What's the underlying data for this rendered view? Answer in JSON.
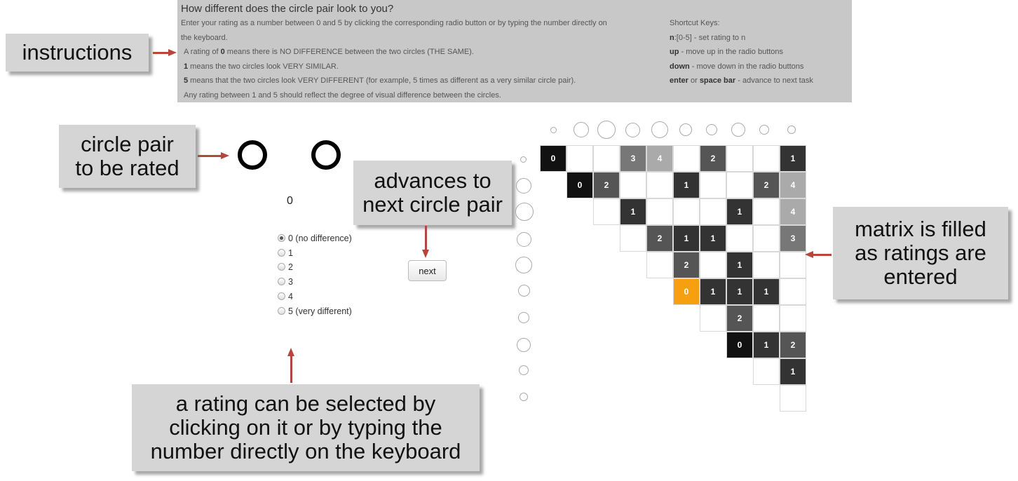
{
  "instructions": {
    "title": "How different does the circle pair look to you?",
    "line1": "Enter your rating as a number between 0 and 5 by clicking the corresponding radio button or by typing the number directly on",
    "line2": "the keyboard.",
    "line3_pre": "A rating of ",
    "line3_bold": "0",
    "line3_post": " means there is NO DIFFERENCE between the two circles (THE SAME).",
    "line4_bold": "1",
    "line4_post": " means the two circles look VERY SIMILAR.",
    "line5_bold": "5",
    "line5_post": " means that the two circles look VERY DIFFERENT (for example, 5 times as different as a very similar circle pair).",
    "line6": "Any rating between 1 and 5 should reflect the degree of visual difference between the circles.",
    "shortcuts_title": "Shortcut Keys:",
    "sc1_key": "n",
    "sc1_text": ":[0-5] - set rating to n",
    "sc2_key": "up",
    "sc2_text": " - move up in the radio buttons",
    "sc3_key": "down",
    "sc3_text": " - move down in the radio buttons",
    "sc4_key1": "enter",
    "sc4_mid": " or ",
    "sc4_key2": "space bar",
    "sc4_text": " - advance to next task"
  },
  "callouts": {
    "instructions": "instructions",
    "circle_pair_1": "circle pair",
    "circle_pair_2": "to be rated",
    "advances_1": "advances to",
    "advances_2": "next circle pair",
    "matrix_1": "matrix is filled",
    "matrix_2": "as ratings are",
    "matrix_3": "entered",
    "rating_1": "a rating can be selected by",
    "rating_2": "clicking on it or by typing the",
    "rating_3": "number directly on the keyboard"
  },
  "rating": {
    "current_value": "0",
    "options": [
      "0 (no difference)",
      "1",
      "2",
      "3",
      "4",
      "5 (very different)"
    ],
    "selected_index": 0
  },
  "next_label": "next",
  "colors": {
    "accent_arrow": "#b5463c",
    "highlight_cell": "#f7a00f"
  }
}
